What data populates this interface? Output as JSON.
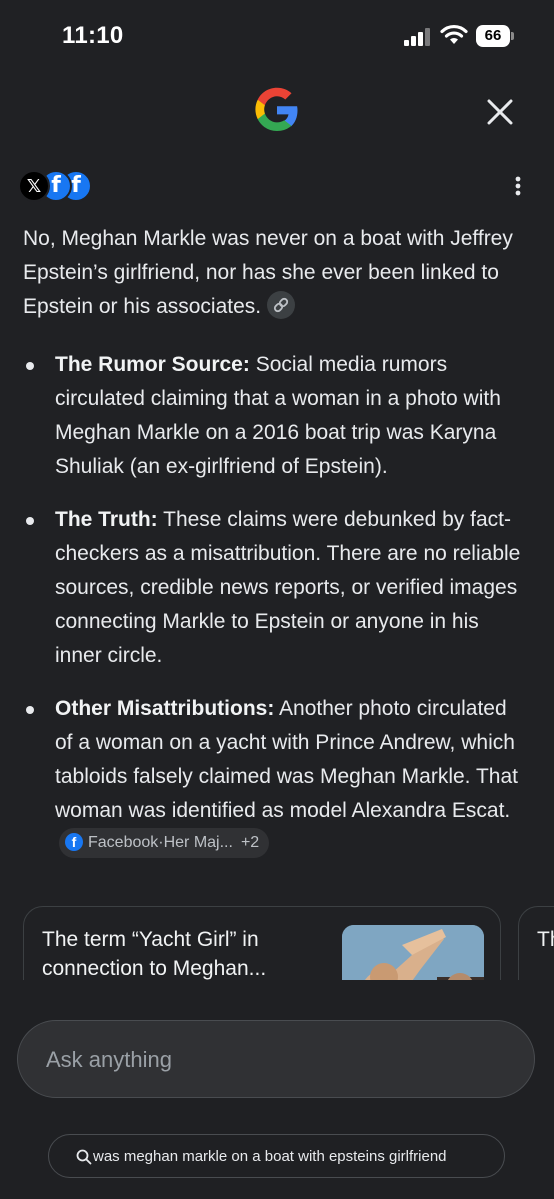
{
  "status_bar": {
    "time": "11:10",
    "battery": "66"
  },
  "header": {
    "logo": "google-g-icon",
    "close_icon": "close-icon"
  },
  "sources": {
    "icons": [
      "x-icon",
      "facebook-icon",
      "facebook-icon"
    ],
    "x_glyph": "𝕏",
    "fb_glyph": "f",
    "more_icon": "more-vert-icon"
  },
  "answer": {
    "intro": "No, Meghan Markle was never on a boat with Jeffrey Epstein’s girlfriend, nor has she ever been linked to Epstein or his associates.",
    "bullets": [
      {
        "label": "The Rumor Source:",
        "text": " Social media rumors circulated claiming that a woman in a photo with Meghan Markle on a 2016 boat trip was Karyna Shuliak (an ex-girlfriend of Epstein)."
      },
      {
        "label": "The Truth:",
        "text": " These claims were debunked by fact-checkers as a misattribution. There are no reliable sources, credible news reports, or verified images connecting Markle to Epstein or anyone in his inner circle."
      },
      {
        "label": "Other Misattributions:",
        "text": " Another photo circulated of a woman on a yacht with Prince Andrew, which tabloids falsely claimed was Meghan Markle. That woman was identified as model Alexandra Escat."
      }
    ],
    "source_chip": {
      "source": "Facebook",
      "separator": "·",
      "more": "Her Maj...",
      "count": "+2"
    }
  },
  "cards": [
    {
      "title": "The term “Yacht Girl” in connection to Meghan..."
    },
    {
      "title": "Th re"
    }
  ],
  "composer": {
    "placeholder": "Ask anything"
  },
  "query_chip": {
    "text": "was meghan markle on a boat with epsteins girlfriend"
  },
  "colors": {
    "background": "#202124",
    "text": "#e8eaed",
    "chip": "#303134",
    "facebook": "#1877f2"
  }
}
